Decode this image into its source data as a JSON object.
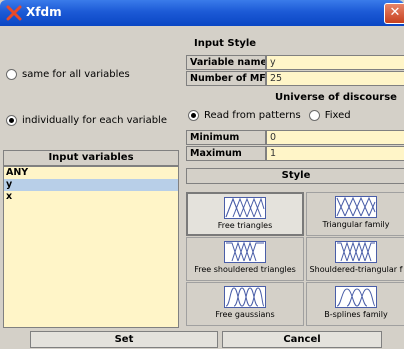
{
  "window": {
    "title": "Xfdm",
    "close_glyph": "✕"
  },
  "left": {
    "option_same": "same for all variables",
    "option_individual": "individually for each variable",
    "input_variables_header": "Input variables",
    "variables": [
      "ANY",
      "y",
      "x"
    ],
    "selected_variable": "y"
  },
  "input_style": {
    "header": "Input Style",
    "variable_name_label": "Variable name",
    "variable_name_value": "y",
    "number_mfs_label": "Number of MFs",
    "number_mfs_value": "25",
    "universe_header": "Universe of discourse",
    "read_from_patterns": "Read from patterns",
    "fixed": "Fixed",
    "minimum_label": "Minimum",
    "minimum_value": "0",
    "maximum_label": "Maximum",
    "maximum_value": "1"
  },
  "style": {
    "header": "Style",
    "options": [
      "Free triangles",
      "Triangular family",
      "Free shouldered triangles",
      "Shouldered-triangular f",
      "Free gaussians",
      "B-splines family"
    ]
  },
  "buttons": {
    "set": "Set",
    "cancel": "Cancel"
  },
  "colors": {
    "titlebar": "#0a46c4",
    "panel": "#d4d0c8",
    "field_bg": "#fff5c8",
    "selection": "#b8cfe8",
    "close": "#c6401e"
  }
}
